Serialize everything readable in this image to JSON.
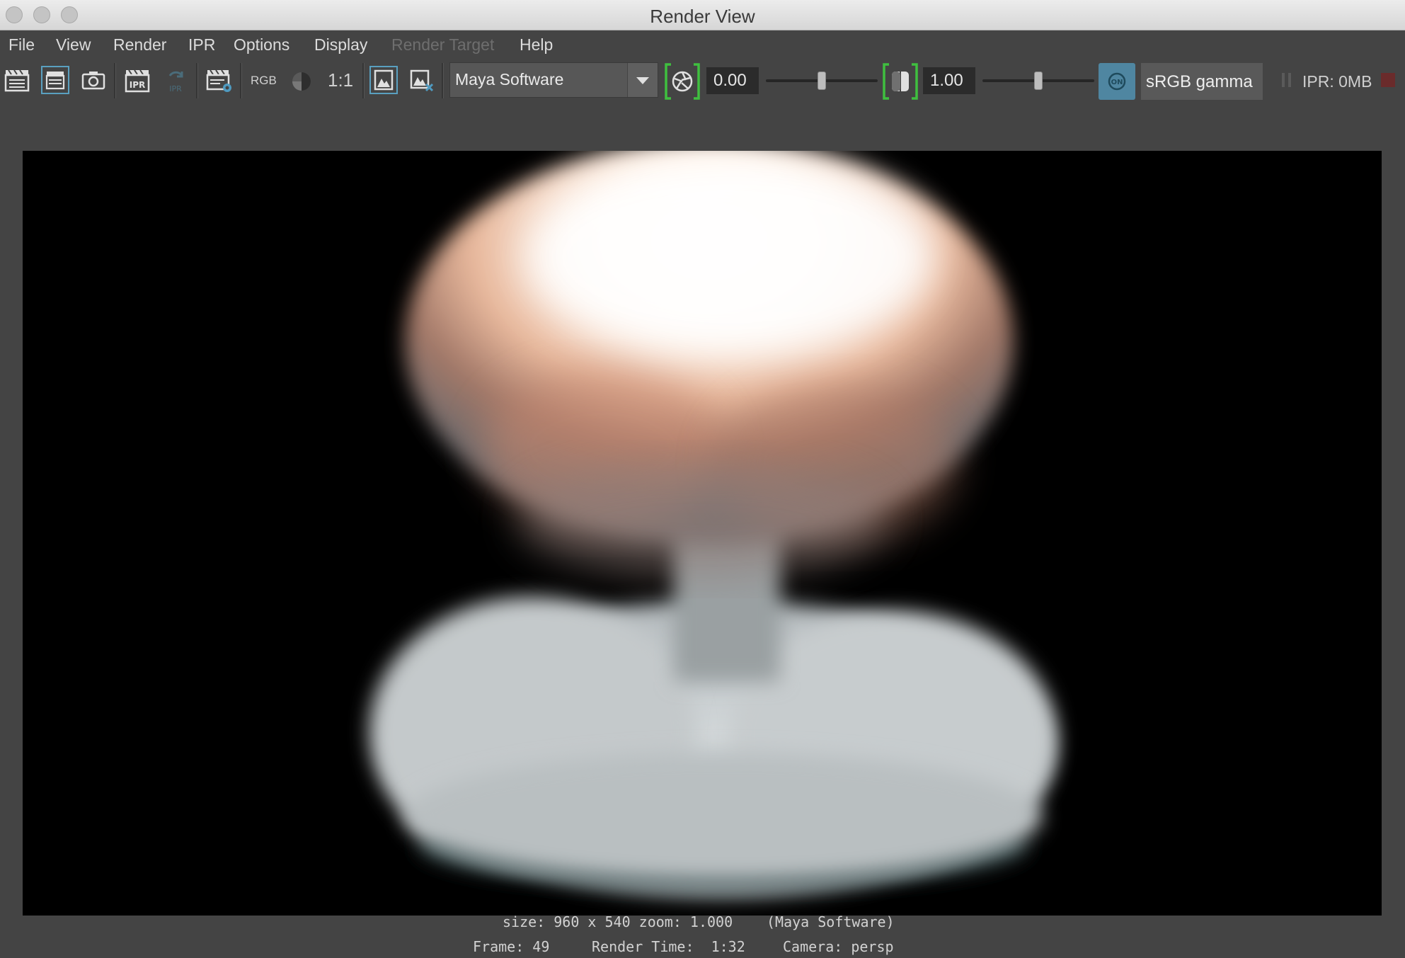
{
  "window": {
    "title": "Render View"
  },
  "menu": {
    "items": [
      {
        "label": "File",
        "enabled": true
      },
      {
        "label": "View",
        "enabled": true
      },
      {
        "label": "Render",
        "enabled": true
      },
      {
        "label": "IPR",
        "enabled": true
      },
      {
        "label": "Options",
        "enabled": true
      },
      {
        "label": "Display",
        "enabled": true
      },
      {
        "label": "Render Target",
        "enabled": false
      },
      {
        "label": "Help",
        "enabled": true
      }
    ]
  },
  "toolbar": {
    "rgb_label": "RGB",
    "ratio_label": "1:1",
    "renderer": "Maya Software",
    "exposure": "0.00",
    "gamma": "1.00",
    "exposure_level": 0.5,
    "gamma_level": 0.5,
    "color_management_on": true,
    "color_management_badge": "ON",
    "view_transform": "sRGB gamma",
    "ipr_memory": "IPR: 0MB",
    "accent_color": "#4f86a1"
  },
  "icons": [
    "clapper-render-icon",
    "clapper-region-render-icon",
    "snapshot-camera-icon",
    "ipr-render-icon",
    "ipr-refresh-icon",
    "render-settings-icon",
    "rgb-channels-icon",
    "alpha-channel-icon",
    "keep-image-icon",
    "remove-image-icon",
    "exposure-icon",
    "gamma-icon",
    "pause-icon",
    "stop-icon"
  ],
  "render_info": {
    "line1_size": "size: 960 x 540 zoom: 1.000",
    "line1_renderer": "(Maya Software)",
    "line2_frame": "Frame: 49",
    "line2_time": "Render Time:  1:32",
    "line2_camera": "Camera: persp"
  }
}
